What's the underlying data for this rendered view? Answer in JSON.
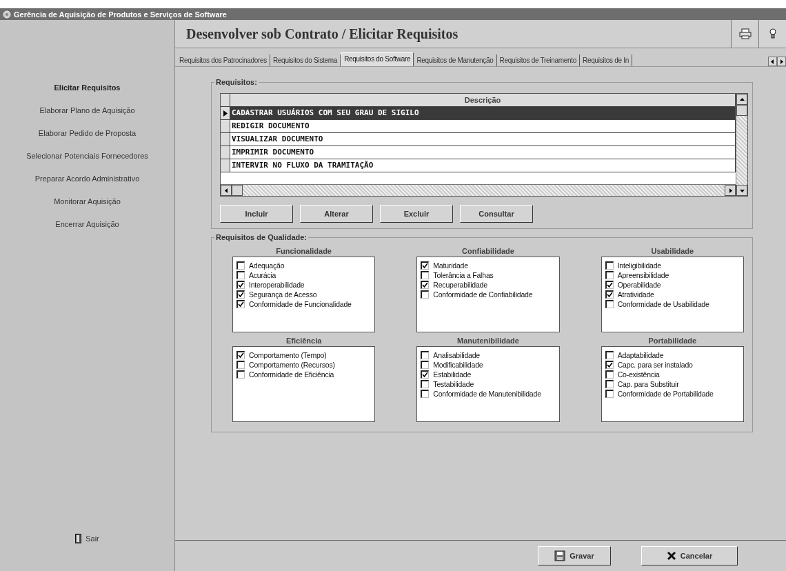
{
  "window": {
    "title": "Gerência de Aquisição de Produtos e Serviços de Software"
  },
  "sidebar": {
    "items": [
      {
        "label": "Elicitar Requisitos",
        "selected": true
      },
      {
        "label": "Elaborar Plano de Aquisição",
        "selected": false
      },
      {
        "label": "Elaborar Pedido de Proposta",
        "selected": false
      },
      {
        "label": "Selecionar Potenciais Fornecedores",
        "selected": false
      },
      {
        "label": "Preparar Acordo Administrativo",
        "selected": false
      },
      {
        "label": "Monitorar Aquisição",
        "selected": false
      },
      {
        "label": "Encerrar Aquisição",
        "selected": false
      }
    ],
    "exit": "Sair"
  },
  "header": {
    "title": "Desenvolver sob Contrato / Elicitar Requisitos"
  },
  "tabs": [
    {
      "label": "Requisitos dos Patrocinadores",
      "selected": false
    },
    {
      "label": "Requisitos do Sistema",
      "selected": false
    },
    {
      "label": "Requisitos do Software",
      "selected": true
    },
    {
      "label": "Requisitos de Manutenção",
      "selected": false
    },
    {
      "label": "Requisitos de Treinamento",
      "selected": false
    },
    {
      "label": "Requisitos de In",
      "selected": false
    }
  ],
  "requirements": {
    "label": "Requisitos:",
    "column": "Descrição",
    "rows": [
      {
        "text": "CADASTRAR USUÁRIOS COM SEU GRAU DE SIGILO",
        "selected": true
      },
      {
        "text": "REDIGIR DOCUMENTO",
        "selected": false
      },
      {
        "text": "VISUALIZAR DOCUMENTO",
        "selected": false
      },
      {
        "text": "IMPRIMIR DOCUMENTO",
        "selected": false
      },
      {
        "text": "INTERVIR NO FLUXO DA TRAMITAÇÃO",
        "selected": false
      }
    ],
    "buttons": [
      "Incluir",
      "Alterar",
      "Excluir",
      "Consultar"
    ]
  },
  "quality": {
    "label": "Requisitos de Qualidade:",
    "groups": [
      {
        "title": "Funcionalidade",
        "items": [
          {
            "label": "Adequação",
            "checked": false
          },
          {
            "label": "Acurácia",
            "checked": false
          },
          {
            "label": "Interoperabilidade",
            "checked": true
          },
          {
            "label": "Segurança de Acesso",
            "checked": true
          },
          {
            "label": "Conformidade de Funcionalidade",
            "checked": true
          }
        ]
      },
      {
        "title": "Confiabilidade",
        "items": [
          {
            "label": "Maturidade",
            "checked": true
          },
          {
            "label": "Tolerância a Falhas",
            "checked": false
          },
          {
            "label": "Recuperabilidade",
            "checked": true
          },
          {
            "label": "Conformidade de Confiabilidade",
            "checked": false
          }
        ]
      },
      {
        "title": "Usabilidade",
        "items": [
          {
            "label": "Inteligibilidade",
            "checked": false
          },
          {
            "label": "Apreensibilidade",
            "checked": false
          },
          {
            "label": "Operabilidade",
            "checked": true
          },
          {
            "label": "Atratividade",
            "checked": true
          },
          {
            "label": "Conformidade de Usabilidade",
            "checked": false
          }
        ]
      },
      {
        "title": "Eficiência",
        "items": [
          {
            "label": "Comportamento (Tempo)",
            "checked": true
          },
          {
            "label": "Comportamento (Recursos)",
            "checked": false
          },
          {
            "label": "Conformidade de Eficiência",
            "checked": false
          }
        ]
      },
      {
        "title": "Manutenibilidade",
        "items": [
          {
            "label": "Analisabilidade",
            "checked": false
          },
          {
            "label": "Modificabilidade",
            "checked": false
          },
          {
            "label": "Estabilidade",
            "checked": true
          },
          {
            "label": "Testabilidade",
            "checked": false
          },
          {
            "label": "Conformidade de Manutenibilidade",
            "checked": false
          }
        ]
      },
      {
        "title": "Portabilidade",
        "items": [
          {
            "label": "Adaptabilidade",
            "checked": false
          },
          {
            "label": "Capc. para ser instalado",
            "checked": true
          },
          {
            "label": "Co-existência",
            "checked": false
          },
          {
            "label": "Cap. para Substituir",
            "checked": false
          },
          {
            "label": "Conformidade de Portabilidade",
            "checked": false
          }
        ]
      }
    ]
  },
  "footer": {
    "save": "Gravar",
    "cancel": "Cancelar"
  }
}
